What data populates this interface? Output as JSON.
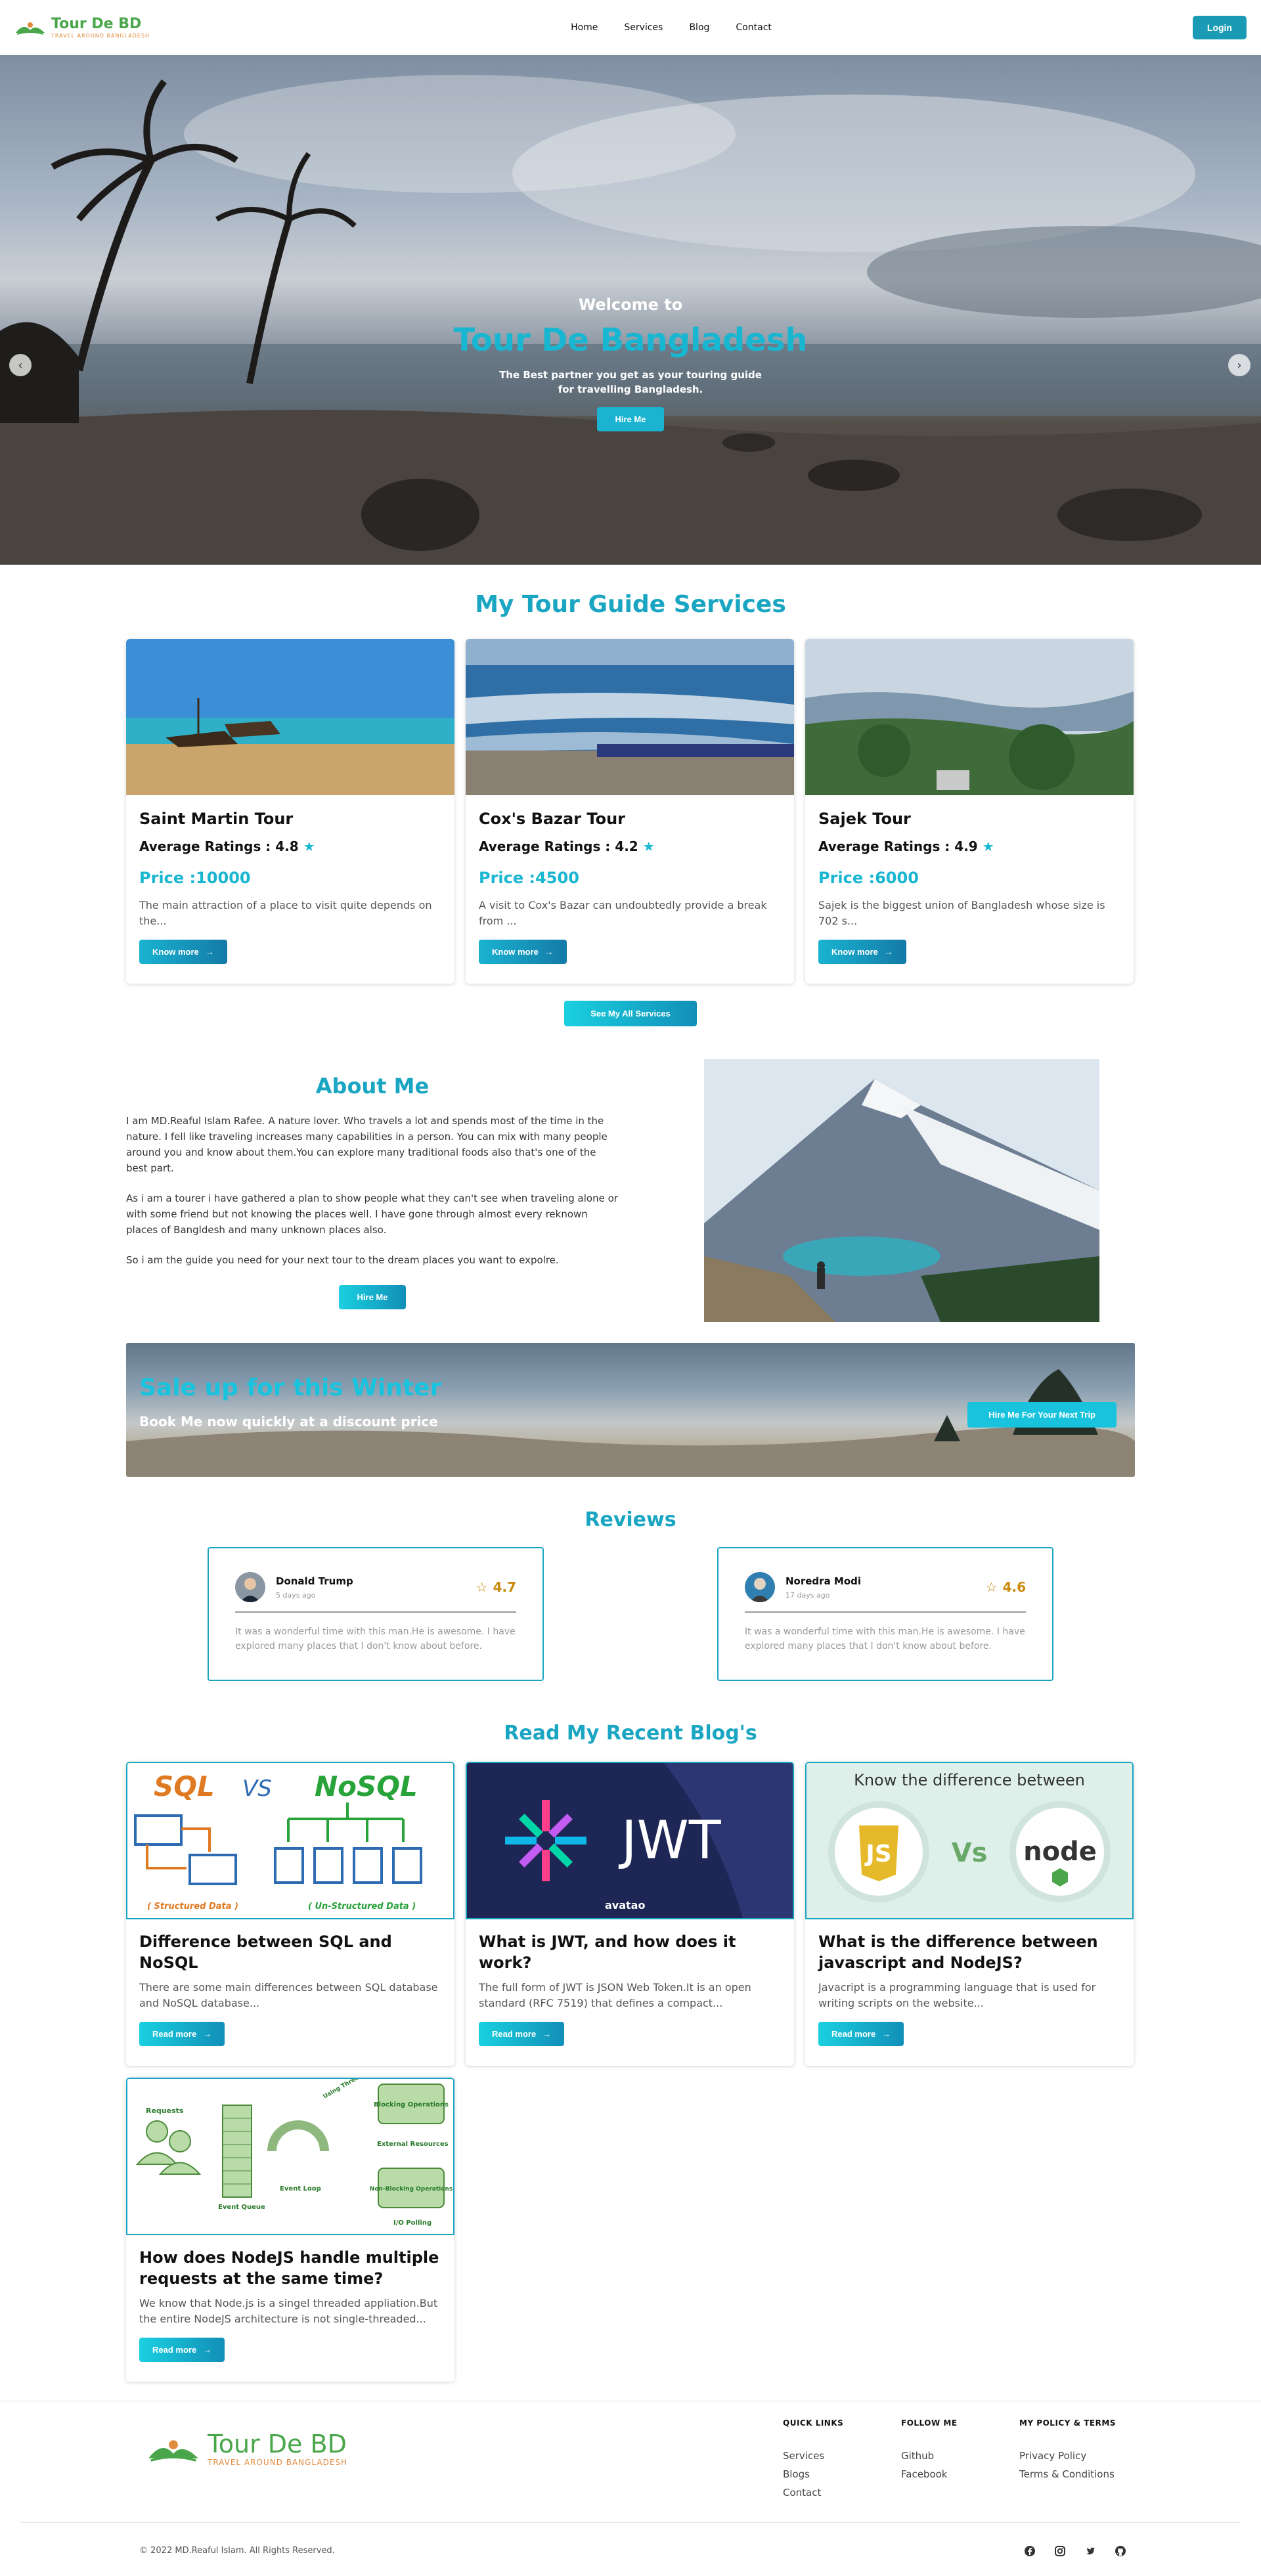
{
  "nav": {
    "brand": {
      "name": "Tour De BD",
      "tagline": "TRAVEL AROUND BANGLADESH"
    },
    "links": [
      "Home",
      "Services",
      "Blog",
      "Contact"
    ],
    "login_label": "Login"
  },
  "hero": {
    "welcome": "Welcome to",
    "title": "Tour De Bangladesh",
    "subtitle_line1": "The Best partner you get as your touring guide",
    "subtitle_line2": "for travelling Bangladesh.",
    "cta": "Hire Me"
  },
  "services": {
    "title": "My Tour Guide Services",
    "rating_label": "Average Ratings :",
    "price_label": "Price :",
    "know_more_label": "Know more",
    "items": [
      {
        "name": "Saint Martin Tour",
        "rating": "4.8",
        "price": "10000",
        "desc": "The main attraction of a place to visit quite depends on the..."
      },
      {
        "name": "Cox's Bazar Tour",
        "rating": "4.2",
        "price": "4500",
        "desc": "A visit to Cox's Bazar can undoubtedly provide a break from ..."
      },
      {
        "name": "Sajek Tour",
        "rating": "4.9",
        "price": "6000",
        "desc": "Sajek is the biggest union of Bangladesh whose size is 702 s..."
      }
    ],
    "see_all_label": "See My All Services"
  },
  "about": {
    "title": "About Me",
    "p1": "I am MD.Reaful Islam Rafee. A nature lover. Who travels a lot and spends most of the time in the nature. I fell like traveling increases many capabilities in a person. You can mix with many people around you and know about them.You can explore many traditional foods also that's one of the best part.",
    "p2": "As i am a tourer i have gathered a plan to show people what they can't see when traveling alone or with some friend but not knowing the places well. I have gone through almost every reknown places of Bangldesh and many unknown places also.",
    "p3": "So i am the guide you need for your next tour to the dream places you want to expolre.",
    "cta": "Hire Me"
  },
  "banner": {
    "title": "Sale up for this Winter",
    "subtitle": "Book Me now quickly at a discount price",
    "cta": "Hire Me For Your Next Trip"
  },
  "reviews": {
    "title": "Reviews",
    "items": [
      {
        "name": "Donald Trump",
        "date": "5 days ago",
        "score": "4.7",
        "text": "It was a wonderful time with this man.He is awesome. I have explored many places that I don't know about before."
      },
      {
        "name": "Noredra Modi",
        "date": "17 days ago",
        "score": "4.6",
        "text": "It was a wonderful time with this man.He is awesome. I have explored many places that I don't know about before."
      }
    ]
  },
  "blogs": {
    "title": "Read My Recent Blog's",
    "read_more_label": "Read more",
    "items": [
      {
        "title": "Difference between SQL and NoSQL",
        "desc": "There are some main differences between SQL database and NoSQL database...",
        "img": {
          "sql": "SQL",
          "vs": "VS",
          "nosql": "NoSQL",
          "left_caption": "( Structured Data )",
          "right_caption": "( Un-Structured Data )"
        }
      },
      {
        "title": "What is JWT, and how does it work?",
        "desc": "The full form of JWT is JSON Web Token.It is an open standard (RFC 7519) that defines a compact...",
        "img": {
          "logo_text": "JWT",
          "brand": "avatao"
        }
      },
      {
        "title": "What is the difference between javascript and NodeJS?",
        "desc": "Javacript is a programming language that is used for writing scripts on the website...",
        "img": {
          "heading": "Know the difference between",
          "js": "JS",
          "vs": "Vs",
          "node": "node"
        }
      },
      {
        "title": "How does NodeJS handle multiple requests at the same time?",
        "desc": "We know that Node.js is a singel threaded appliation.But the entire NodeJS architecture is not single-threaded...",
        "img": {
          "requests": "Requests",
          "event_queue": "Event Queue",
          "event_loop": "Event Loop",
          "thread_pool": "Using Thread Pool",
          "blocking": "Blocking Operations",
          "external": "External Resources",
          "non_blocking": "Non-Blocking Operations",
          "io": "I/O Polling"
        }
      }
    ]
  },
  "footer": {
    "brand": {
      "name": "Tour De BD",
      "tagline": "TRAVEL AROUND BANGLADESH"
    },
    "columns": [
      {
        "title": "QUICK LINKS",
        "links": [
          "Services",
          "Blogs",
          "Contact"
        ]
      },
      {
        "title": "FOLLOW ME",
        "links": [
          "Github",
          "Facebook"
        ]
      },
      {
        "title": "MY POLICY & TERMS",
        "links": [
          "Privacy Policy",
          "Terms & Conditions"
        ]
      }
    ],
    "copyright": "© 2022 MD.Reaful Islam. All Rights Reserved.",
    "socials": [
      "facebook-icon",
      "instagram-icon",
      "twitter-icon",
      "github-icon"
    ]
  },
  "colors": {
    "accent": "#1aa6c2",
    "brand_green": "#4aa64a",
    "brand_orange": "#e08a3c",
    "star": "#c98a0c"
  }
}
